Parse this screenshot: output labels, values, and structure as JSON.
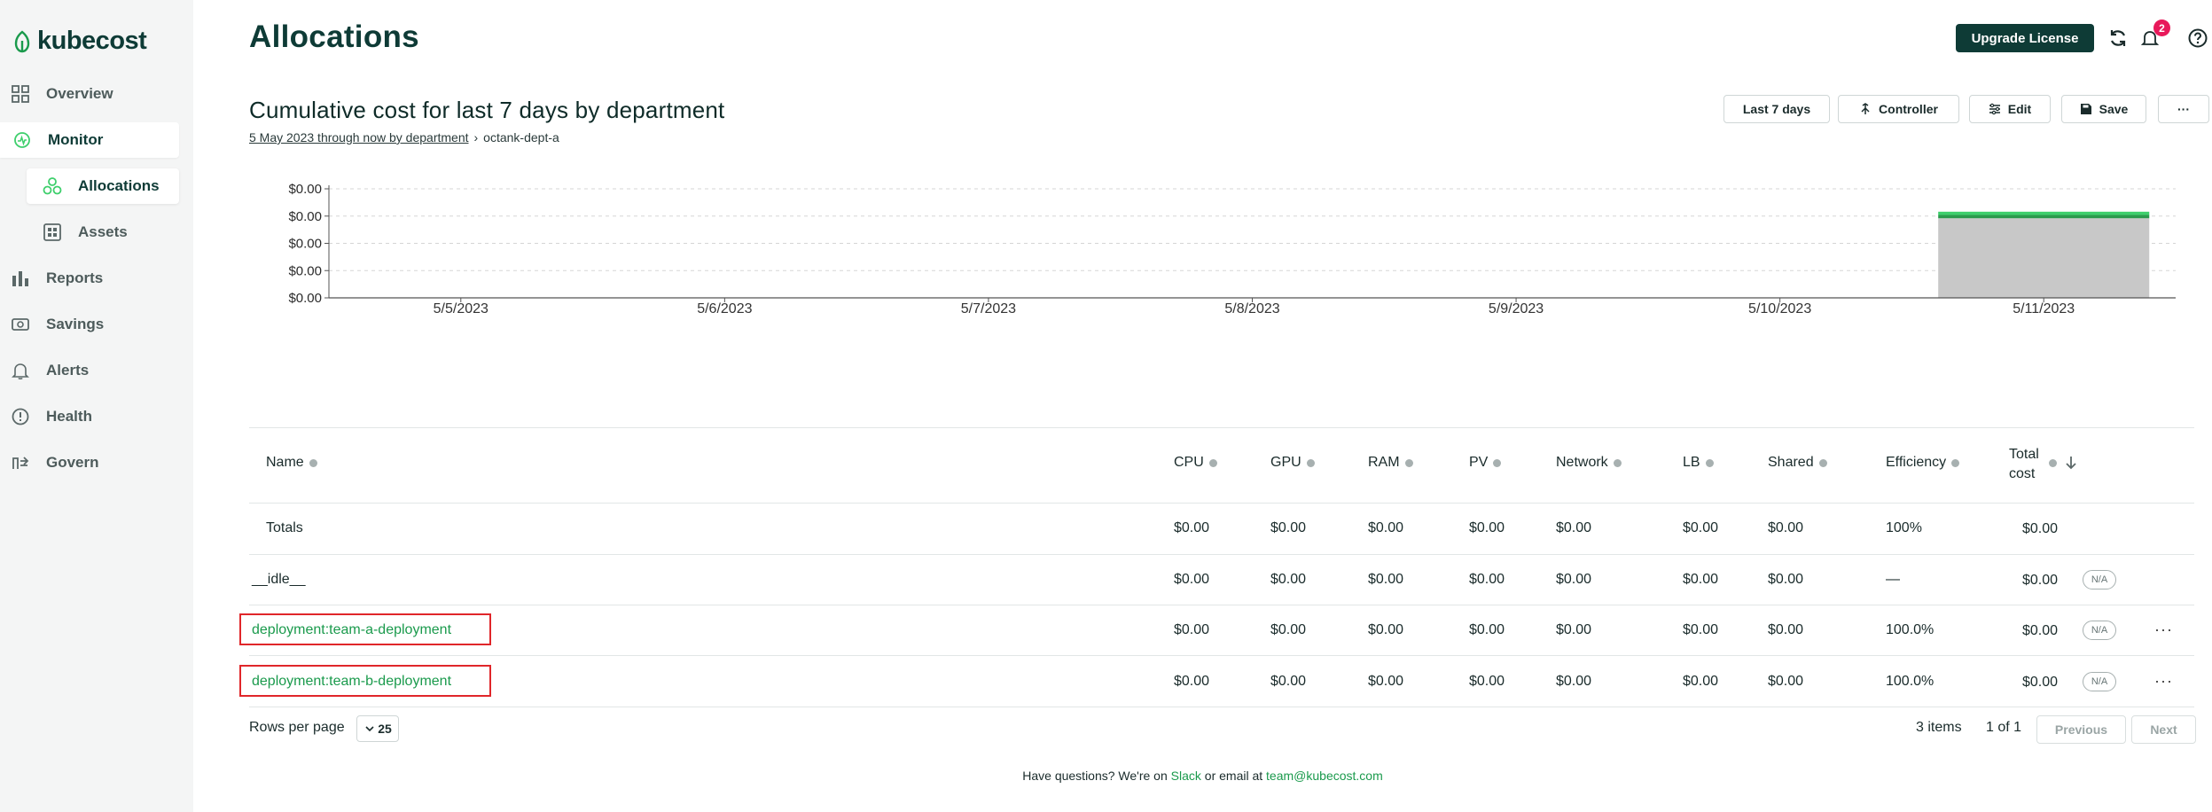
{
  "app": {
    "logo_text": "kubecost"
  },
  "sidebar": {
    "items": [
      {
        "label": "Overview",
        "icon": "grid-icon"
      },
      {
        "label": "Monitor",
        "icon": "monitor-icon"
      },
      {
        "label": "Allocations",
        "icon": "allocations-icon"
      },
      {
        "label": "Assets",
        "icon": "assets-icon"
      },
      {
        "label": "Reports",
        "icon": "bar-chart-icon"
      },
      {
        "label": "Savings",
        "icon": "savings-icon"
      },
      {
        "label": "Alerts",
        "icon": "bell-icon"
      },
      {
        "label": "Health",
        "icon": "health-icon"
      },
      {
        "label": "Govern",
        "icon": "govern-icon"
      }
    ]
  },
  "header": {
    "title": "Allocations",
    "upgrade_label": "Upgrade License",
    "notification_count": "2"
  },
  "report": {
    "title": "Cumulative cost for last 7 days by department",
    "breadcrumb_link": "5 May 2023 through now by department",
    "breadcrumb_sep": "›",
    "breadcrumb_current": "octank-dept-a",
    "controls": {
      "range": "Last 7 days",
      "aggregate": "Controller",
      "edit": "Edit",
      "save": "Save",
      "more": "···"
    }
  },
  "chart_data": {
    "type": "bar",
    "stacked": true,
    "categories": [
      "5/5/2023",
      "5/6/2023",
      "5/7/2023",
      "5/8/2023",
      "5/9/2023",
      "5/10/2023",
      "5/11/2023"
    ],
    "y_tick_labels": [
      "$0.00",
      "$0.00",
      "$0.00",
      "$0.00",
      "$0.00"
    ],
    "ylim": [
      0,
      1
    ],
    "grid": true,
    "series": [
      {
        "values": [
          0,
          0,
          0,
          0,
          0,
          0,
          0.73
        ],
        "color": "#c8c8c8"
      },
      {
        "values": [
          0,
          0,
          0,
          0,
          0,
          0,
          0.03
        ],
        "color": "#2a9a4c"
      },
      {
        "values": [
          0,
          0,
          0,
          0,
          0,
          0,
          0.03
        ],
        "color": "#3ecf6c"
      }
    ]
  },
  "table": {
    "columns": [
      "Name",
      "CPU",
      "GPU",
      "RAM",
      "PV",
      "Network",
      "LB",
      "Shared",
      "Efficiency"
    ],
    "total_col_line1": "Total",
    "total_col_line2": "cost",
    "rows": [
      {
        "name": "Totals",
        "cpu": "$0.00",
        "gpu": "$0.00",
        "ram": "$0.00",
        "pv": "$0.00",
        "network": "$0.00",
        "lb": "$0.00",
        "shared": "$0.00",
        "efficiency": "100%",
        "total": "$0.00"
      },
      {
        "name": "__idle__",
        "cpu": "$0.00",
        "gpu": "$0.00",
        "ram": "$0.00",
        "pv": "$0.00",
        "network": "$0.00",
        "lb": "$0.00",
        "shared": "$0.00",
        "efficiency": "—",
        "total": "$0.00",
        "badge": "N/A"
      },
      {
        "name": "deployment:team-a-deployment",
        "cpu": "$0.00",
        "gpu": "$0.00",
        "ram": "$0.00",
        "pv": "$0.00",
        "network": "$0.00",
        "lb": "$0.00",
        "shared": "$0.00",
        "efficiency": "100.0%",
        "total": "$0.00",
        "badge": "N/A",
        "menu": "···"
      },
      {
        "name": "deployment:team-b-deployment",
        "cpu": "$0.00",
        "gpu": "$0.00",
        "ram": "$0.00",
        "pv": "$0.00",
        "network": "$0.00",
        "lb": "$0.00",
        "shared": "$0.00",
        "efficiency": "100.0%",
        "total": "$0.00",
        "badge": "N/A",
        "menu": "···"
      }
    ]
  },
  "pagination": {
    "rows_per_page_label": "Rows per page",
    "rows_per_page_value": "25",
    "item_count": "3 items",
    "page_of": "1 of 1",
    "prev": "Previous",
    "next": "Next"
  },
  "footer": {
    "text1": "Have questions? We're on",
    "slack": "Slack",
    "text2": "or email at",
    "email": "team@kubecost.com"
  }
}
